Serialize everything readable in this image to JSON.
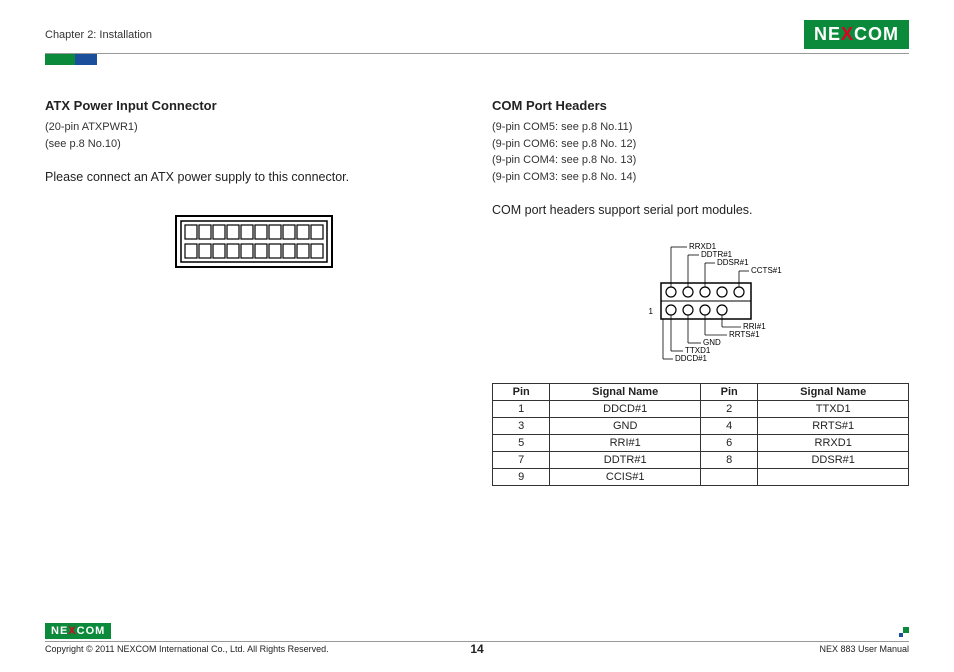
{
  "header": {
    "chapter": "Chapter 2: Installation",
    "brand_left": "NE",
    "brand_x": "X",
    "brand_right": "COM"
  },
  "left": {
    "title": "ATX Power Input Connector",
    "sub1": "(20-pin ATXPWR1)",
    "sub2": "(see p.8 No.10)",
    "body": "Please connect an ATX power supply to this connector."
  },
  "right": {
    "title": "COM Port Headers",
    "sub1": "(9-pin COM5: see p.8 No.11)",
    "sub2": "(9-pin COM6:  see p.8  No. 12)",
    "sub3": "(9-pin COM4:  see p.8  No. 13)",
    "sub4": "(9-pin COM3:  see p.8  No. 14)",
    "body": "COM port headers support serial port modules.",
    "pin1": "1",
    "labels": {
      "rrxd1": "RRXD1",
      "ddtr1": "DDTR#1",
      "ddsr1": "DDSR#1",
      "ccts1": "CCTS#1",
      "rri1": "RRI#1",
      "rrts1": "RRTS#1",
      "gnd": "GND",
      "ttxd1": "TTXD1",
      "ddcd1": "DDCD#1"
    },
    "table": {
      "h_pin": "Pin",
      "h_sig": "Signal Name",
      "rows": [
        {
          "p1": "1",
          "s1": "DDCD#1",
          "p2": "2",
          "s2": "TTXD1"
        },
        {
          "p1": "3",
          "s1": "GND",
          "p2": "4",
          "s2": "RRTS#1"
        },
        {
          "p1": "5",
          "s1": "RRI#1",
          "p2": "6",
          "s2": "RRXD1"
        },
        {
          "p1": "7",
          "s1": "DDTR#1",
          "p2": "8",
          "s2": "DDSR#1"
        },
        {
          "p1": "9",
          "s1": "CCIS#1",
          "p2": "",
          "s2": ""
        }
      ]
    }
  },
  "footer": {
    "copyright": "Copyright © 2011 NEXCOM International Co., Ltd. All Rights Reserved.",
    "page": "14",
    "manual": "NEX 883 User Manual"
  }
}
